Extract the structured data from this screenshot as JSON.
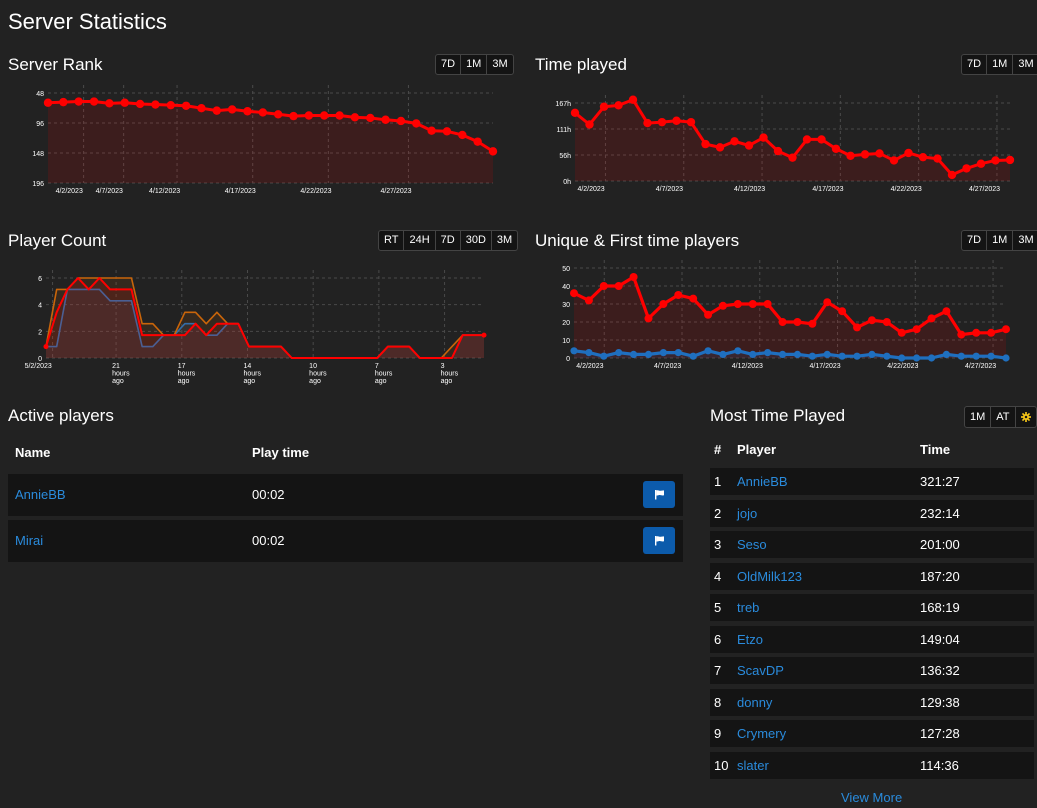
{
  "page": {
    "title": "Server Statistics"
  },
  "server_rank": {
    "title": "Server Rank",
    "buttons": [
      "7D",
      "1M",
      "3M"
    ]
  },
  "time_played": {
    "title": "Time played",
    "buttons": [
      "7D",
      "1M",
      "3M"
    ]
  },
  "player_count": {
    "title": "Player Count",
    "buttons": [
      "RT",
      "24H",
      "7D",
      "30D",
      "3M"
    ]
  },
  "unique_players": {
    "title": "Unique & First time players",
    "buttons": [
      "7D",
      "1M",
      "3M"
    ]
  },
  "active_players": {
    "title": "Active players",
    "col_name": "Name",
    "col_time": "Play time",
    "rows": [
      {
        "name": "AnnieBB",
        "time": "00:02"
      },
      {
        "name": "Mirai",
        "time": "00:02"
      }
    ],
    "flag_icon": "flag-icon"
  },
  "most_time_played": {
    "title": "Most Time Played",
    "buttons": [
      "1M",
      "AT"
    ],
    "settings_icon": "gear-icon",
    "settings_color": "#f5c518",
    "col_rank": "#",
    "col_player": "Player",
    "col_time": "Time",
    "rows": [
      {
        "rank": "1",
        "player": "AnnieBB",
        "time": "321:27"
      },
      {
        "rank": "2",
        "player": "jojo",
        "time": "232:14"
      },
      {
        "rank": "3",
        "player": "Seso",
        "time": "201:00"
      },
      {
        "rank": "4",
        "player": "OldMilk123",
        "time": "187:20"
      },
      {
        "rank": "5",
        "player": "treb",
        "time": "168:19"
      },
      {
        "rank": "6",
        "player": "Etzo",
        "time": "149:04"
      },
      {
        "rank": "7",
        "player": "ScavDP",
        "time": "136:32"
      },
      {
        "rank": "8",
        "player": "donny",
        "time": "129:38"
      },
      {
        "rank": "9",
        "player": "Crymery",
        "time": "127:28"
      },
      {
        "rank": "10",
        "player": "slater",
        "time": "114:36"
      }
    ],
    "view_more": "View More"
  },
  "colors": {
    "series_red": "#ff0000",
    "series_blue": "#1f6fbf",
    "series_orange": "#c9650a",
    "link": "#2a8bdc",
    "flag_button": "#0c5bab"
  },
  "chart_data": [
    {
      "id": "rank",
      "type": "line",
      "yticks": [
        "48",
        "96",
        "148",
        "196"
      ],
      "ylim": [
        48,
        196
      ],
      "y_inverted": true,
      "xticks": [
        "4/2/2023",
        "4/7/2023",
        "4/12/2023",
        "4/17/2023",
        "4/22/2023",
        "4/27/2023"
      ],
      "x": [
        "4/1",
        "4/2",
        "4/3",
        "4/4",
        "4/5",
        "4/6",
        "4/7",
        "4/8",
        "4/9",
        "4/10",
        "4/11",
        "4/12",
        "4/13",
        "4/14",
        "4/15",
        "4/16",
        "4/17",
        "4/18",
        "4/19",
        "4/20",
        "4/21",
        "4/22",
        "4/23",
        "4/24",
        "4/25",
        "4/26",
        "4/27",
        "4/28",
        "4/29",
        "4/30"
      ],
      "series": [
        {
          "color": "#ff0000",
          "values": [
            64,
            63,
            62,
            62,
            65,
            64,
            66,
            67,
            68,
            69,
            73,
            77,
            75,
            78,
            80,
            83,
            86,
            85,
            85,
            85,
            88,
            89,
            92,
            94,
            98,
            110,
            111,
            117,
            128,
            144
          ]
        }
      ]
    },
    {
      "id": "time",
      "type": "line",
      "yticks": [
        "0h",
        "56h",
        "111h",
        "167h"
      ],
      "ylim": [
        0,
        167
      ],
      "xticks": [
        "4/2/2023",
        "4/7/2023",
        "4/12/2023",
        "4/17/2023",
        "4/22/2023",
        "4/27/2023"
      ],
      "x": [
        "4/1",
        "4/2",
        "4/3",
        "4/4",
        "4/5",
        "4/6",
        "4/7",
        "4/8",
        "4/9",
        "4/10",
        "4/11",
        "4/12",
        "4/13",
        "4/14",
        "4/15",
        "4/16",
        "4/17",
        "4/18",
        "4/19",
        "4/20",
        "4/21",
        "4/22",
        "4/23",
        "4/24",
        "4/25",
        "4/26",
        "4/27",
        "4/28",
        "4/29",
        "4/30",
        "5/1"
      ],
      "series": [
        {
          "color": "#ff0000",
          "values": [
            146,
            121,
            159,
            162,
            174,
            124,
            126,
            129,
            126,
            79,
            72,
            85,
            76,
            93,
            64,
            50,
            89,
            89,
            69,
            54,
            57,
            59,
            44,
            60,
            51,
            48,
            13,
            27,
            37,
            44,
            45
          ]
        }
      ]
    },
    {
      "id": "players",
      "type": "line",
      "yticks": [
        "0",
        "2",
        "4",
        "6"
      ],
      "ylim": [
        0,
        7
      ],
      "xticks": [
        "5/2/2023",
        "21 hours ago",
        "17 hours ago",
        "14 hours ago",
        "10 hours ago",
        "7 hours ago",
        "3 hours ago"
      ],
      "series": [
        {
          "name": "",
          "color": "#1f6fbf",
          "values": [
            1,
            1,
            6,
            6,
            6,
            6,
            5,
            5,
            5,
            1,
            1,
            2,
            2,
            3,
            3,
            2,
            2,
            3,
            3,
            1,
            1,
            1,
            1,
            0,
            0,
            0,
            0,
            0,
            0,
            0,
            0,
            0,
            1,
            1,
            1,
            0,
            0,
            0,
            0,
            2,
            2,
            2
          ]
        },
        {
          "name": "",
          "color": "#c9650a",
          "values": [
            1,
            6,
            6,
            7,
            7,
            7,
            7,
            7,
            7,
            3,
            3,
            2,
            2,
            4,
            4,
            3,
            4,
            3,
            3,
            1,
            1,
            1,
            1,
            0,
            0,
            0,
            0,
            0,
            0,
            0,
            0,
            0,
            1,
            1,
            1,
            0,
            0,
            0,
            1,
            2,
            2,
            2
          ]
        },
        {
          "name": "",
          "color": "#ff0000",
          "values": [
            1,
            4,
            6,
            7,
            6,
            7,
            6,
            6,
            6,
            2,
            2,
            2,
            2,
            2,
            3,
            2,
            3,
            3,
            3,
            1,
            1,
            1,
            1,
            0,
            0,
            0,
            0,
            0,
            0,
            0,
            0,
            0,
            1,
            1,
            1,
            0,
            0,
            0,
            0,
            2,
            2,
            2
          ]
        }
      ]
    },
    {
      "id": "unique",
      "type": "line",
      "yticks": [
        "0",
        "10",
        "20",
        "30",
        "40",
        "50"
      ],
      "ylim": [
        0,
        50
      ],
      "xticks": [
        "4/2/2023",
        "4/7/2023",
        "4/12/2023",
        "4/17/2023",
        "4/22/2023",
        "4/27/2023"
      ],
      "series": [
        {
          "name": "",
          "color": "#ff0000",
          "values": [
            36,
            32,
            40,
            40,
            45,
            22,
            30,
            35,
            33,
            24,
            29,
            30,
            30,
            30,
            20,
            20,
            19,
            31,
            26,
            17,
            21,
            20,
            14,
            16,
            22,
            26,
            13,
            14,
            14,
            16
          ]
        },
        {
          "name": "",
          "color": "#1f6fbf",
          "values": [
            4,
            3,
            1,
            3,
            2,
            2,
            3,
            3,
            1,
            4,
            2,
            4,
            2,
            3,
            2,
            2,
            1,
            2,
            1,
            1,
            2,
            1,
            0,
            0,
            0,
            2,
            1,
            1,
            1,
            0
          ]
        }
      ]
    }
  ]
}
